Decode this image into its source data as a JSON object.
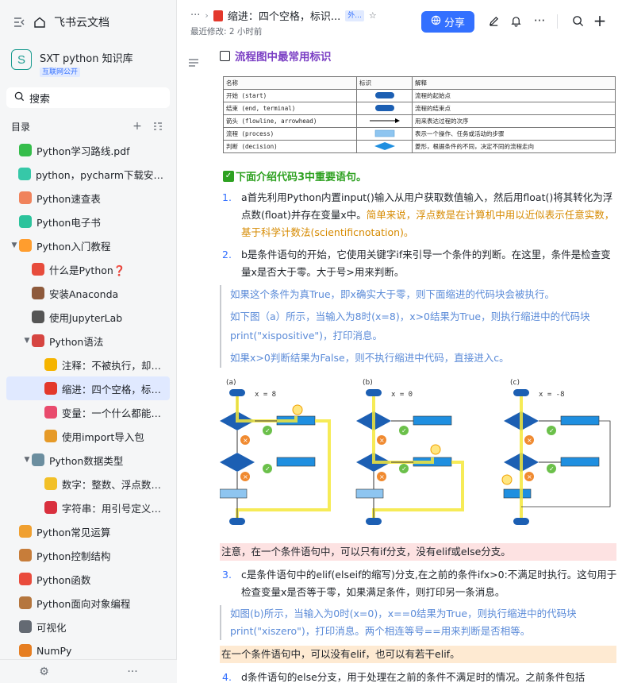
{
  "app": {
    "brand": "飞书云文档"
  },
  "knowledge_base": {
    "logo_letter": "S",
    "title": "SXT python 知识库",
    "badge": "互联网公开"
  },
  "search": {
    "label": "搜索"
  },
  "toc": {
    "label": "目录"
  },
  "tree": [
    {
      "label": "Python学习路线.pdf",
      "level": 0,
      "icon_color": "#35bd4b",
      "arrow": ""
    },
    {
      "label": "python，pycharm下载安装教...",
      "level": 0,
      "icon_color": "#36c8a8",
      "arrow": ""
    },
    {
      "label": "Python速查表",
      "level": 0,
      "icon_color": "#f0835c",
      "arrow": ""
    },
    {
      "label": "Python电子书",
      "level": 0,
      "icon_color": "#2cc39c",
      "arrow": ""
    },
    {
      "label": "Python入门教程",
      "level": 0,
      "icon_color": "#ff9d2e",
      "arrow": "▼"
    },
    {
      "label": "什么是Python❓",
      "level": 1,
      "icon_color": "#e74c3c",
      "arrow": ""
    },
    {
      "label": "安装Anaconda",
      "level": 1,
      "icon_color": "#8e5a3c",
      "arrow": ""
    },
    {
      "label": "使用JupyterLab",
      "level": 1,
      "icon_color": "#555555",
      "arrow": ""
    },
    {
      "label": "Python语法",
      "level": 1,
      "icon_color": "#d64541",
      "arrow": "▼"
    },
    {
      "label": "注释：不被执行，却很...",
      "level": 2,
      "icon_color": "#f5b400",
      "arrow": ""
    },
    {
      "label": "缩进：四个空格，标识...",
      "level": 2,
      "icon_color": "#e3382c",
      "arrow": "",
      "active": true
    },
    {
      "label": "变量：一个什么都能装...",
      "level": 2,
      "icon_color": "#e94b6d",
      "arrow": ""
    },
    {
      "label": "使用import导入包",
      "level": 2,
      "icon_color": "#e69a28",
      "arrow": ""
    },
    {
      "label": "Python数据类型",
      "level": 1,
      "icon_color": "#6b8e9f",
      "arrow": "▼"
    },
    {
      "label": "数字：整数、浮点数、...",
      "level": 2,
      "icon_color": "#f2c028",
      "arrow": ""
    },
    {
      "label": "字符串：用引号定义的...",
      "level": 2,
      "icon_color": "#d9303e",
      "arrow": ""
    },
    {
      "label": "Python常见运算",
      "level": 0,
      "icon_color": "#f0a030",
      "arrow": ""
    },
    {
      "label": "Python控制结构",
      "level": 0,
      "icon_color": "#c77d3a",
      "arrow": ""
    },
    {
      "label": "Python函数",
      "level": 0,
      "icon_color": "#e94b3c",
      "arrow": ""
    },
    {
      "label": "Python面向对象编程",
      "level": 0,
      "icon_color": "#b5763e",
      "arrow": ""
    },
    {
      "label": "可视化",
      "level": 0,
      "icon_color": "#646a73",
      "arrow": ""
    },
    {
      "label": "NumPy",
      "level": 0,
      "icon_color": "#e67e22",
      "arrow": ""
    }
  ],
  "header": {
    "breadcrumb_dots": "···",
    "title": "缩进：四个空格，标识...",
    "ext_badge": "外...",
    "modified": "最近修改: 2 小时前",
    "share": "分享"
  },
  "doc": {
    "heading": "流程图中最常用标识",
    "table": {
      "headers": [
        "名称",
        "标识",
        "解释"
      ],
      "rows": [
        [
          "开始 (start)",
          "terminal",
          "流程的起始点"
        ],
        [
          "结束 (end, terminal)",
          "terminal",
          "流程的结束点"
        ],
        [
          "箭头 (flowline, arrowhead)",
          "arrow",
          "用来表达过程的次序"
        ],
        [
          "流程 (process)",
          "process",
          "表示一个操作、任务或活动的步骤"
        ],
        [
          "判断 (decision)",
          "decision",
          "菱形，根据条件的不同，决定不同的流程走向"
        ]
      ]
    },
    "green_line": "下面介绍代码3中重要语句。",
    "item1_num": "1.",
    "item1_a": "a首先利用Python内置input()输入从用户获取数值输入，然后用float()将其转化为浮点数(float)并存在变量x中。",
    "item1_b": "简单来说，浮点数是在计算机中用以近似表示任意实数，基于科学计数法(scientificnotation)。",
    "item2_num": "2.",
    "item2": "b是条件语句的开始，它使用关键字if来引导一个条件的判断。在这里，条件是检查变量x是否大于零。大于号>用来判断。",
    "quote1_1": "如果这个条件为真True，即x确实大于零，则下面缩进的代码块会被执行。",
    "quote1_2": "如下图（a）所示，当输入为8时(x=8)，x>0结果为True，则执行缩进中的代码块print(\"xispositive\")，打印消息。",
    "quote1_3": "如果x>0判断结果为False，则不执行缩进中代码，直接进入c。",
    "diagram_labels": {
      "a": "(a)",
      "b": "(b)",
      "c": "(c)",
      "a_val": "x = 8",
      "b_val": "x = 0",
      "c_val": "x = -8"
    },
    "note_red": "注意，在一个条件语句中，可以只有if分支，没有elif或else分支。",
    "item3_num": "3.",
    "item3": "c是条件语句中的elif(elseif的缩写)分支,在之前的条件ifx>0:不满足时执行。这句用于检查变量x是否等于零，如果满足条件，则打印另一条消息。",
    "quote2": "如图(b)所示，当输入为0时(x=0)，x==0结果为True，则执行缩进中的代码块print(\"xiszero\")，打印消息。两个相连等号==用来判断是否相等。",
    "note_orange": "在一个条件语句中，可以没有elif，也可以有若干elif。",
    "item4_num": "4.",
    "item4": "d条件语句的else分支，用于处理在之前的条件不满足时的情况。之前条件包括"
  },
  "colors": {
    "accent": "#3370ff",
    "green": "#2ea121",
    "purple": "#7b3fc4",
    "orange_text": "#d68a00",
    "quote_text": "#5b8bd8"
  }
}
